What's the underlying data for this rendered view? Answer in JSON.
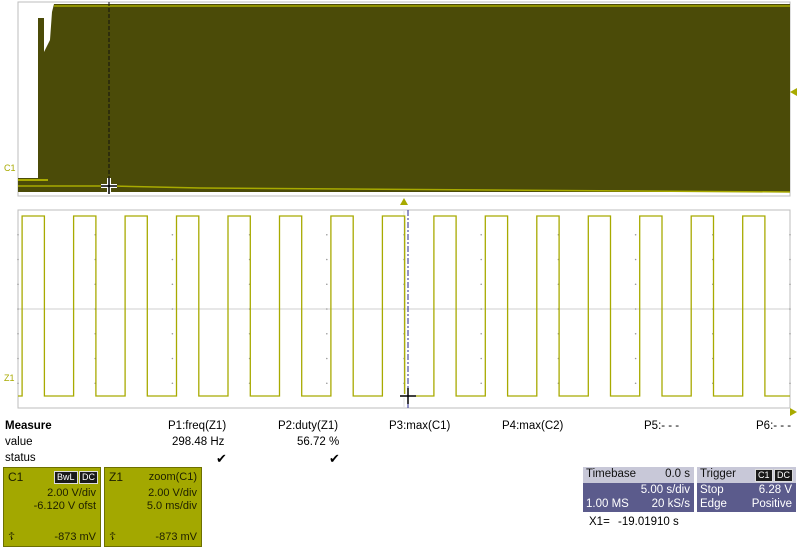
{
  "channels": {
    "c1_label": "C1",
    "z1_label": "Z1",
    "trace_color": "#a8aa00",
    "envelope_fill": "#4b4b08"
  },
  "measure": {
    "headers": [
      "Measure",
      "P1:freq(Z1)",
      "P2:duty(Z1)",
      "P3:max(C1)",
      "P4:max(C2)",
      "P5:- - -",
      "P6:- - -"
    ],
    "row_value_label": "value",
    "row_status_label": "status",
    "p1_value": "298.48 Hz",
    "p2_value": "56.72 %",
    "status_icon": "checkmark-icon"
  },
  "c1_descriptor": {
    "title": "C1",
    "badge_bwl": "BwL",
    "badge_dc": "DC",
    "vdiv": "2.00 V/div",
    "offset": "-6.120 V ofst",
    "level": "-873 mV"
  },
  "z1_descriptor": {
    "title": "Z1",
    "source": "zoom(C1)",
    "vdiv": "2.00 V/div",
    "tdiv": "5.0 ms/div",
    "level": "-873 mV"
  },
  "timebase": {
    "title": "Timebase",
    "delay": "0.0 s",
    "tdiv": "5.00 s/div",
    "samples": "1.00 MS",
    "rate": "20 kS/s"
  },
  "cursor": {
    "x1_label": "X1=",
    "x1_value": "-19.01910 s"
  },
  "trigger": {
    "title": "Trigger",
    "badge_c1": "C1",
    "badge_dc": "DC",
    "mode": "Stop",
    "level": "6.28 V",
    "type": "Edge",
    "slope": "Positive"
  },
  "zoom_wave": {
    "periods": 15,
    "duty": 0.5672
  }
}
